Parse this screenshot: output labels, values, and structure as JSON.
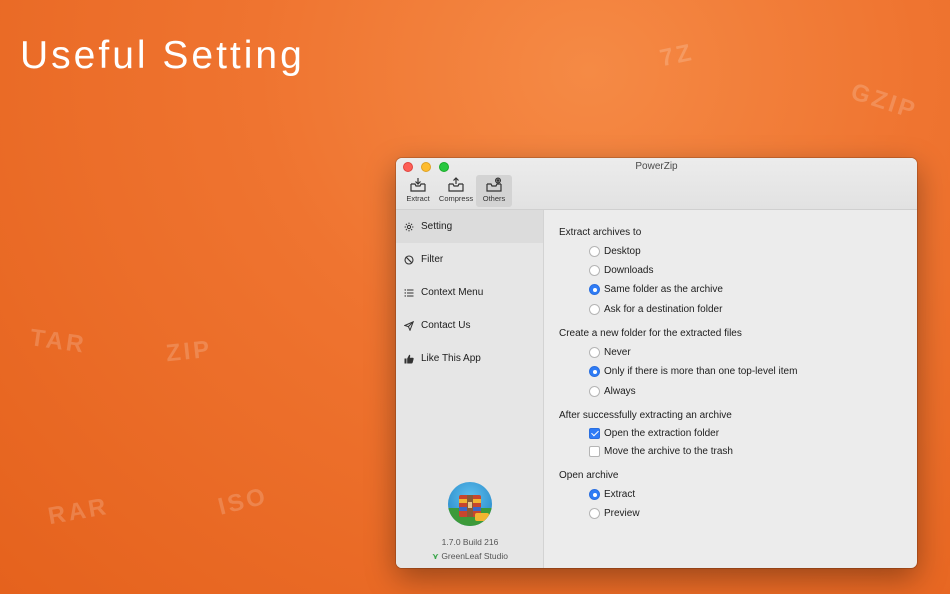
{
  "headline": "Useful Setting",
  "watermarks": [
    "7Z",
    "GZIP",
    "TAR",
    "ZIP",
    "RAR",
    "ISO"
  ],
  "window": {
    "title": "PowerZip",
    "toolbar": [
      {
        "label": "Extract",
        "icon": "extract-icon"
      },
      {
        "label": "Compress",
        "icon": "compress-icon"
      },
      {
        "label": "Others",
        "icon": "others-icon",
        "selected": true
      }
    ]
  },
  "sidebar": {
    "items": [
      {
        "label": "Setting",
        "icon": "gear-icon",
        "selected": true
      },
      {
        "label": "Filter",
        "icon": "block-icon"
      },
      {
        "label": "Context Menu",
        "icon": "list-icon"
      },
      {
        "label": "Contact Us",
        "icon": "paper-plane-icon"
      },
      {
        "label": "Like This App",
        "icon": "thumbs-up-icon"
      }
    ],
    "version": "1.7.0  Build 216",
    "studio": "GreenLeaf Studio"
  },
  "settings": {
    "extract_to": {
      "title": "Extract archives to",
      "options": [
        "Desktop",
        "Downloads",
        "Same folder as the archive",
        "Ask for a destination folder"
      ],
      "selected": 2
    },
    "new_folder": {
      "title": "Create a new folder for the extracted files",
      "options": [
        "Never",
        "Only if there is more than one top-level item",
        "Always"
      ],
      "selected": 1
    },
    "after_extract": {
      "title": "After successfully extracting an archive",
      "options": [
        "Open the extraction folder",
        "Move the archive to the trash"
      ],
      "checked": [
        true,
        false
      ]
    },
    "open_archive": {
      "title": "Open archive",
      "options": [
        "Extract",
        "Preview"
      ],
      "selected": 0
    }
  }
}
